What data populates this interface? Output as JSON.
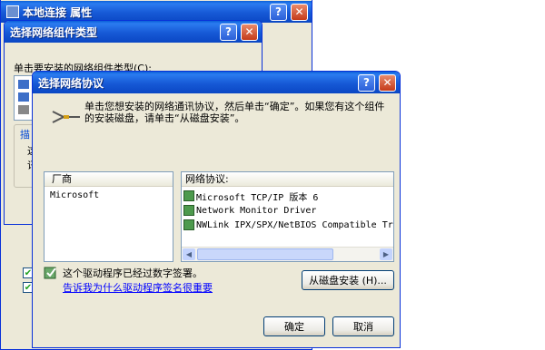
{
  "background_window": {
    "title": "本地连接 属性"
  },
  "component_type_window": {
    "title": "选择网络组件类型",
    "prompt": "单击要安装的网络组件类型(C):",
    "truncated_text_1": "描",
    "truncated_text_2": "这",
    "truncated_text_3": "讯"
  },
  "protocol_dialog": {
    "title": "选择网络协议",
    "instruction": "单击您想安装的网络通讯协议，然后单击“确定”。如果您有这个组件的安装磁盘，请单击“从磁盘安装”。",
    "manufacturer_header": "厂商",
    "manufacturers": [
      "Microsoft"
    ],
    "protocol_header": "网络协议:",
    "protocols": [
      "Microsoft TCP/IP 版本 6",
      "Network Monitor Driver",
      "NWLink IPX/SPX/NetBIOS Compatible Trans"
    ],
    "signed_text": "这个驱动程序已经过数字签署。",
    "signing_link": "告诉我为什么驱动程序签名很重要",
    "have_disk_button": "从磁盘安装 (H)...",
    "ok_button": "确定",
    "cancel_button": "取消"
  },
  "colors": {
    "title_bar": "#1659d6",
    "dialog_bg": "#ece9d8",
    "link": "#0000ff",
    "selection": "#316ac5"
  }
}
